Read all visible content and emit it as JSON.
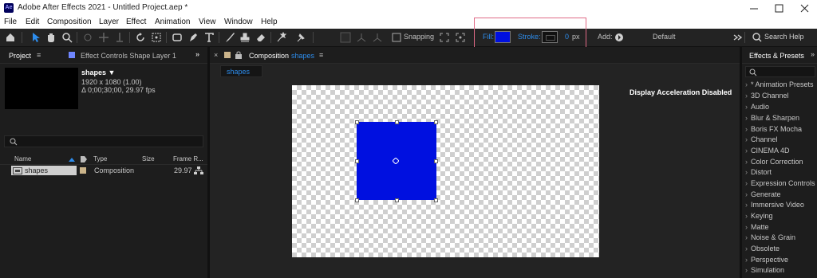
{
  "window": {
    "title": "Adobe After Effects 2021 - Untitled Project.aep *",
    "logo": "Ae"
  },
  "menu": [
    "File",
    "Edit",
    "Composition",
    "Layer",
    "Effect",
    "Animation",
    "View",
    "Window",
    "Help"
  ],
  "toolbar": {
    "snapping_label": "Snapping",
    "fill_label": "Fill:",
    "fill_color": "#0010e0",
    "stroke_label": "Stroke:",
    "stroke_value": "0",
    "stroke_unit": "px",
    "add_label": "Add:",
    "workspace": "Default",
    "search_help": "Search Help"
  },
  "project_panel": {
    "tab_project": "Project",
    "tab_effect_controls": "Effect Controls Shape Layer 1",
    "item_name": "shapes ▼",
    "item_size": "1920 x 1080 (1.00)",
    "item_duration": "Δ 0;00;30;00, 29.97 fps",
    "search_placeholder": "",
    "columns": [
      "Name",
      "Type",
      "Size",
      "Frame R..."
    ],
    "rows": [
      {
        "name": "shapes",
        "type": "Composition",
        "size": "",
        "fps": "29.97"
      }
    ]
  },
  "comp_panel": {
    "close": "×",
    "tab_prefix": "Composition",
    "tab_name": "shapes",
    "subtab": "shapes",
    "status": "Display Acceleration Disabled",
    "shape_color": "#0010e0"
  },
  "effects_panel": {
    "title": "Effects & Presets",
    "items": [
      "* Animation Presets",
      "3D Channel",
      "Audio",
      "Blur & Sharpen",
      "Boris FX Mocha",
      "Channel",
      "CINEMA 4D",
      "Color Correction",
      "Distort",
      "Expression Controls",
      "Generate",
      "Immersive Video",
      "Keying",
      "Matte",
      "Noise & Grain",
      "Obsolete",
      "Perspective",
      "Simulation"
    ]
  },
  "colors": {
    "accent": "#2d8ceb",
    "highlight_box": "#e06a86"
  }
}
